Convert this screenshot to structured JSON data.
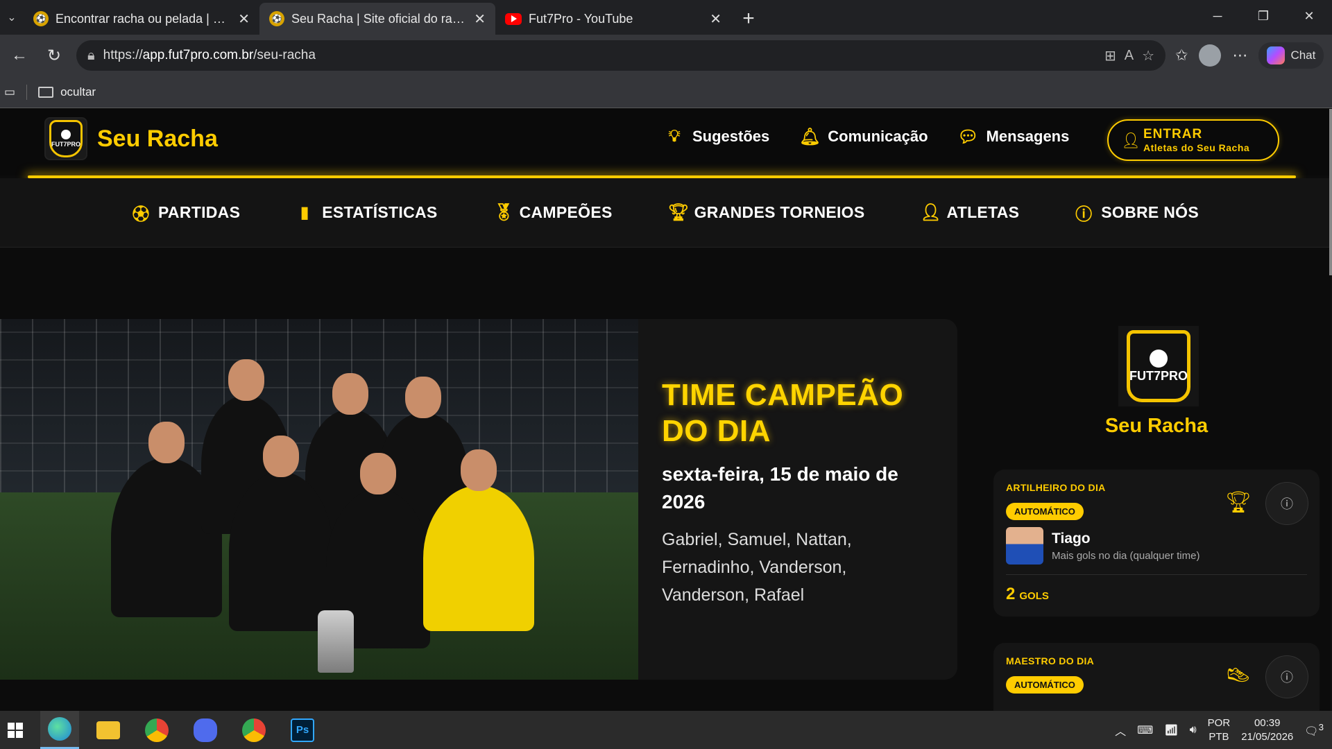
{
  "browser": {
    "tabs": [
      {
        "title": "Encontrar racha ou pelada | Fut7Pro",
        "active": false
      },
      {
        "title": "Seu Racha | Site oficial do racha no Fut7Pro",
        "active": true
      },
      {
        "title": "Fut7Pro - YouTube",
        "active": false
      }
    ],
    "new_tab": "+",
    "url_prefix": "https://",
    "url_host": "app.fut7pro.com.br",
    "url_path": "/seu-racha",
    "chat_label": "Chat",
    "bookmark_folder": "ocultar"
  },
  "site": {
    "name": "Seu Racha",
    "logo_text": "FUT7PRO",
    "top_links": [
      "Sugestões",
      "Comunicação",
      "Mensagens"
    ],
    "enter_label": "ENTRAR",
    "enter_sub": "Atletas do Seu Racha",
    "nav": [
      "PARTIDAS",
      "ESTATÍSTICAS",
      "CAMPEÕES",
      "GRANDES TORNEIOS",
      "ATLETAS",
      "SOBRE NÓS"
    ]
  },
  "hero": {
    "title": "TIME CAMPEÃO DO DIA",
    "date": "sexta-feira, 15 de maio de 2026",
    "players": "Gabriel, Samuel, Nattan, Fernadinho, Vanderson, Vanderson, Rafael"
  },
  "sidebar": {
    "name": "Seu Racha",
    "awards": [
      {
        "title": "ARTILHEIRO DO DIA",
        "badge": "AUTOMÁTICO",
        "player": "Tiago",
        "desc": "Mais gols no dia (qualquer time)",
        "count": "2",
        "unit": "GOLS"
      },
      {
        "title": "MAESTRO DO DIA",
        "badge": "AUTOMÁTICO"
      }
    ]
  },
  "taskbar": {
    "lang_top": "POR",
    "lang_bottom": "PTB",
    "time": "00:39",
    "date": "21/05/2026",
    "notif_count": "3"
  },
  "colors": {
    "accent": "#ffcc00",
    "background": "#0c0c0c"
  }
}
